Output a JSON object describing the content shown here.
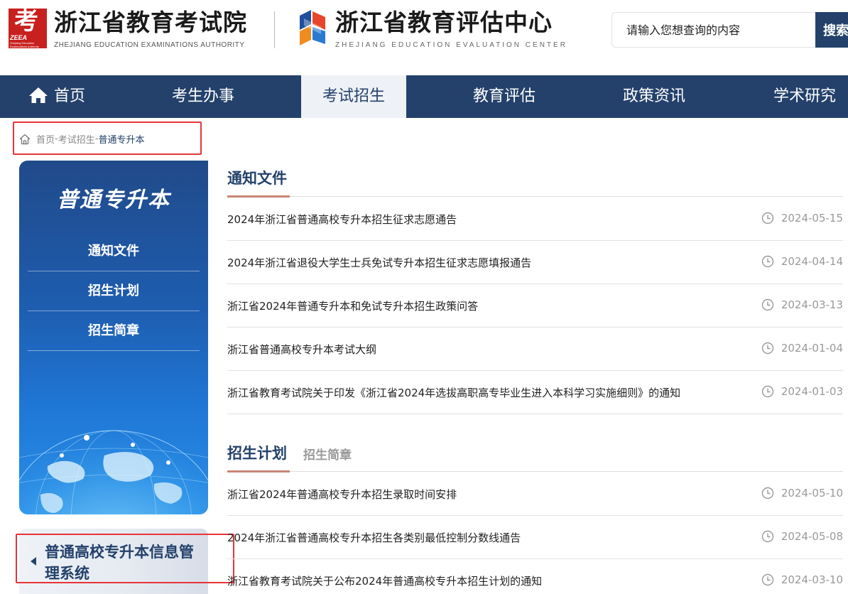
{
  "header": {
    "logo1_mark": "考",
    "logo1_mark_en": "ZEEA",
    "logo1_mark_sub": "Zhejiang Education Examinations Authority",
    "logo1_name": "浙江省教育考试院",
    "logo1_en": "ZHEJIANG EDUCATION EXAMINATIONS AUTHORITY",
    "logo2_name": "浙江省教育评估中心",
    "logo2_en": "ZHEJIANG EDUCATION EVALUATION CENTER",
    "search_placeholder": "请输入您想查询的内容",
    "search_button": "搜索"
  },
  "nav": {
    "items": [
      {
        "label": "首页",
        "icon": "home-icon"
      },
      {
        "label": "考生办事"
      },
      {
        "label": "考试招生",
        "active": true
      },
      {
        "label": "教育评估"
      },
      {
        "label": "政策资讯"
      },
      {
        "label": "学术研究"
      }
    ],
    "bg_color": "#24416b"
  },
  "breadcrumb": {
    "home": "首页",
    "sep1": "-",
    "section": "考试招生",
    "sep2": "-",
    "current": "普通专升本"
  },
  "sidebar": {
    "title": "普通专升本",
    "items": [
      {
        "label": "通知文件"
      },
      {
        "label": "招生计划"
      },
      {
        "label": "招生简章"
      }
    ]
  },
  "banner": {
    "text": "普通高校专升本信息管理系统"
  },
  "sections": [
    {
      "title": "通知文件",
      "items": [
        {
          "title": "2024年浙江省普通高校专升本招生征求志愿通告",
          "date": "2024-05-15"
        },
        {
          "title": "2024年浙江省退役大学生士兵免试专升本招生征求志愿填报通告",
          "date": "2024-04-14"
        },
        {
          "title": "浙江省2024年普通专升本和免试专升本招生政策问答",
          "date": "2024-03-13"
        },
        {
          "title": "浙江省普通高校专升本考试大纲",
          "date": "2024-01-04"
        },
        {
          "title": "浙江省教育考试院关于印发《浙江省2024年选拔高职高专毕业生进入本科学习实施细则》的通知",
          "date": "2024-01-03"
        }
      ]
    },
    {
      "title": "招生计划",
      "tab2": "招生简章",
      "items": [
        {
          "title": "浙江省2024年普通高校专升本招生录取时间安排",
          "date": "2024-05-10"
        },
        {
          "title": "2024年浙江省普通高校专升本招生各类别最低控制分数线通告",
          "date": "2024-05-08"
        },
        {
          "title": "浙江省教育考试院关于公布2024年普通高校专升本招生计划的通知",
          "date": "2024-03-10"
        }
      ]
    }
  ]
}
